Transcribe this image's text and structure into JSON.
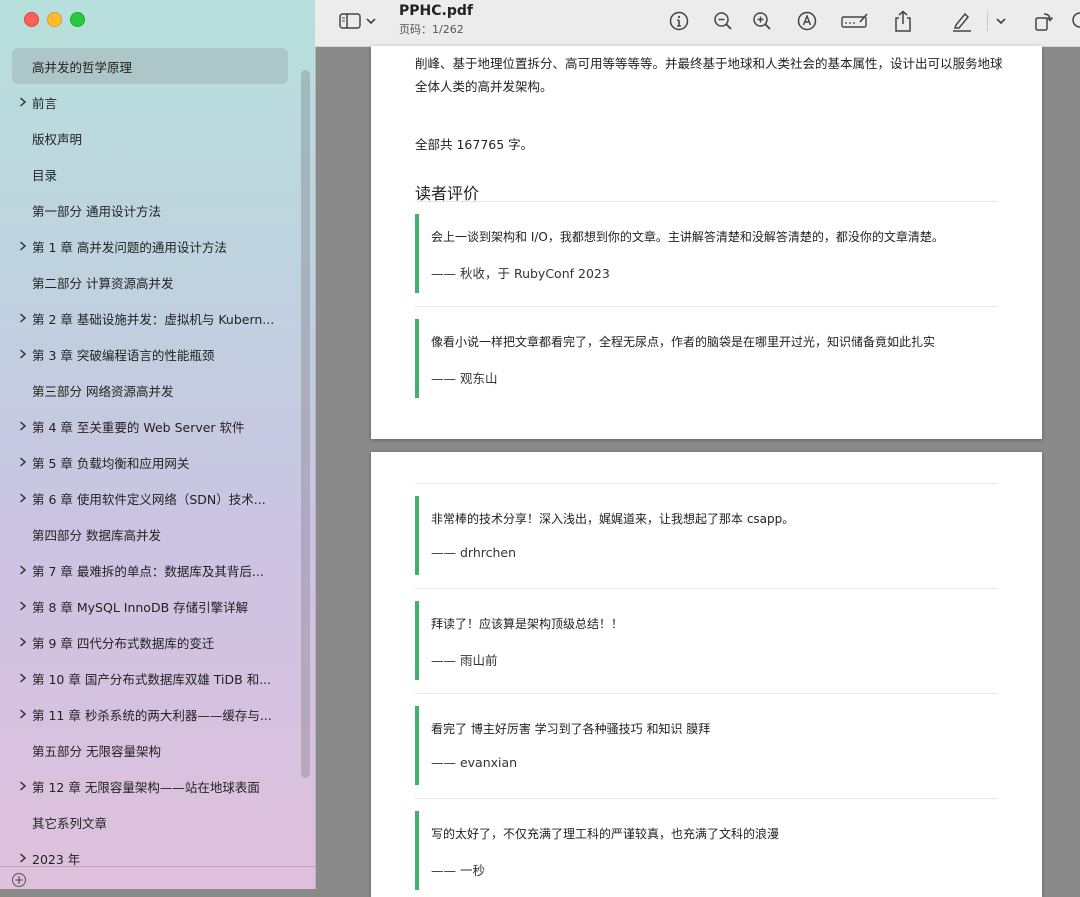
{
  "sidebar": {
    "items": [
      {
        "label": "高并发的哲学原理",
        "expandable": false,
        "selected": true
      },
      {
        "label": "前言",
        "expandable": true
      },
      {
        "label": "版权声明",
        "expandable": false
      },
      {
        "label": "目录",
        "expandable": false
      },
      {
        "label": "第一部分 通用设计方法",
        "expandable": false
      },
      {
        "label": "第 1 章 高并发问题的通用设计方法",
        "expandable": true
      },
      {
        "label": "第二部分 计算资源高并发",
        "expandable": false
      },
      {
        "label": "第 2 章 基础设施并发：虚拟机与 Kubern...",
        "expandable": true
      },
      {
        "label": "第 3 章 突破编程语言的性能瓶颈",
        "expandable": true
      },
      {
        "label": "第三部分 网络资源高并发",
        "expandable": false
      },
      {
        "label": "第 4 章 至关重要的 Web Server 软件",
        "expandable": true
      },
      {
        "label": "第 5 章 负载均衡和应用网关",
        "expandable": true
      },
      {
        "label": "第 6 章 使用软件定义网络（SDN）技术...",
        "expandable": true
      },
      {
        "label": "第四部分 数据库高并发",
        "expandable": false
      },
      {
        "label": "第 7 章 最难拆的单点：数据库及其背后...",
        "expandable": true
      },
      {
        "label": "第 8 章 MySQL InnoDB 存储引擎详解",
        "expandable": true
      },
      {
        "label": "第 9 章 四代分布式数据库的变迁",
        "expandable": true
      },
      {
        "label": "第 10 章 国产分布式数据库双雄 TiDB 和...",
        "expandable": true
      },
      {
        "label": "第 11 章 秒杀系统的两大利器——缓存与...",
        "expandable": true
      },
      {
        "label": "第五部分 无限容量架构",
        "expandable": false
      },
      {
        "label": "第 12 章 无限容量架构——站在地球表面",
        "expandable": true
      },
      {
        "label": "其它系列文章",
        "expandable": false
      },
      {
        "label": "2023 年",
        "expandable": true
      }
    ]
  },
  "toolbar": {
    "title": "PPHC.pdf",
    "page_info": "页码：1/262",
    "icons": [
      "sidebar-toggle-icon",
      "chevron-down-icon",
      "info-icon",
      "zoom-out-icon",
      "zoom-in-icon",
      "markup-icon",
      "signature-icon",
      "share-icon",
      "highlight-icon",
      "chevron-down-icon",
      "rotate-icon",
      "search-icon"
    ]
  },
  "page1": {
    "intro_lines": [
      "削峰、基于地理位置拆分、高可用等等等等。并最终基于地球和人类社会的基本属性，设计出可以服务地球",
      "全体人类的高并发架构。"
    ],
    "word_count": "全部共 167765 字。",
    "heading": "读者评价",
    "reviews": [
      {
        "text": "会上一谈到架构和 I/O，我都想到你的文章。主讲解答清楚和没解答清楚的，都没你的文章清楚。",
        "author": "—— 秋收，于 RubyConf 2023"
      },
      {
        "text": "像看小说一样把文章都看完了，全程无尿点，作者的脑袋是在哪里开过光，知识储备竟如此扎实",
        "author": "—— 观东山"
      }
    ]
  },
  "page2": {
    "reviews": [
      {
        "text": "非常棒的技术分享！深入浅出，娓娓道来，让我想起了那本 csapp。",
        "author": "—— drhrchen"
      },
      {
        "text": "拜读了！应该算是架构顶级总结！！",
        "author": "—— 雨山前"
      },
      {
        "text": "看完了 博主好厉害 学习到了各种骚技巧 和知识 膜拜",
        "author": "—— evanxian"
      },
      {
        "text": "写的太好了，不仅充满了理工科的严谨较真，也充满了文科的浪漫",
        "author": "—— 一秒"
      }
    ]
  },
  "colors": {
    "quote_accent": "#42b06c",
    "selected_row": "#a0aaaf"
  }
}
